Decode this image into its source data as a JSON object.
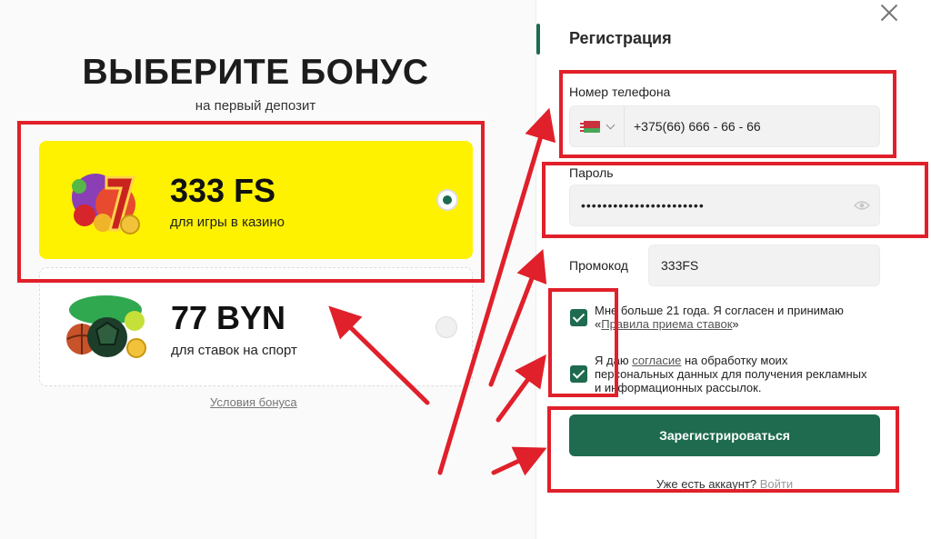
{
  "bonus": {
    "title": "ВЫБЕРИТЕ БОНУС",
    "subtitle": "на первый депозит",
    "options": [
      {
        "value": "333 FS",
        "description": "для игры в казино",
        "selected": true
      },
      {
        "value": "77 BYN",
        "description": "для ставок на спорт",
        "selected": false
      }
    ],
    "terms_link": "Условия бонуса"
  },
  "registration": {
    "title": "Регистрация",
    "phone_label": "Номер телефона",
    "phone_value": "+375(66) 666 - 66 - 66",
    "country_flag": "belarus-flag",
    "password_label": "Пароль",
    "password_value": "•••••••••••••••••••••••",
    "promo_label": "Промокод",
    "promo_value": "333FS",
    "consent_age_text": "Мне больше 21 года. Я согласен и принимаю «",
    "consent_age_link": "Правила приема ставок",
    "consent_age_end": "»",
    "consent_data_pre": "Я даю ",
    "consent_data_link": "согласие",
    "consent_data_text": " на обработку моих персональных данных для получения рекламных и информационных рассылок.",
    "submit_label": "Зарегистрироваться",
    "have_account": "Уже есть аккаунт?",
    "login_link": "Войти"
  },
  "colors": {
    "accent": "#1e6b4f",
    "selected_card": "#fff200",
    "annotation": "#e0202a"
  }
}
